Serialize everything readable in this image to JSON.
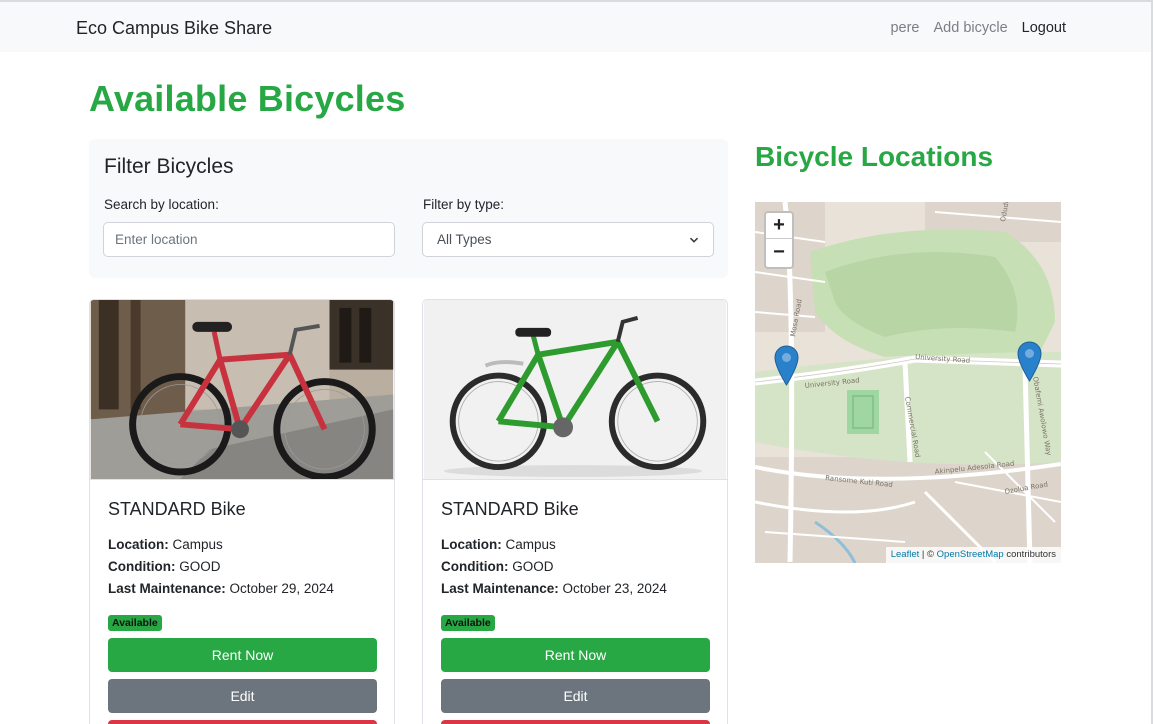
{
  "navbar": {
    "brand": "Eco Campus Bike Share",
    "links": [
      "pere",
      "Add bicycle",
      "Logout"
    ]
  },
  "page": {
    "title": "Available Bicycles"
  },
  "filters": {
    "heading": "Filter Bicycles",
    "location_label": "Search by location:",
    "location_placeholder": "Enter location",
    "location_value": "",
    "type_label": "Filter by type:",
    "type_selected": "All Types"
  },
  "bicycles": [
    {
      "title": "STANDARD Bike",
      "location_label": "Location:",
      "location": "Campus",
      "condition_label": "Condition:",
      "condition": "GOOD",
      "maintenance_label": "Last Maintenance:",
      "maintenance": "October 29, 2024",
      "status": "Available",
      "frame_color": "#c8323f",
      "rent_label": "Rent Now",
      "edit_label": "Edit"
    },
    {
      "title": "STANDARD Bike",
      "location_label": "Location:",
      "location": "Campus",
      "condition_label": "Condition:",
      "condition": "GOOD",
      "maintenance_label": "Last Maintenance:",
      "maintenance": "October 23, 2024",
      "status": "Available",
      "frame_color": "#2e9b2e",
      "rent_label": "Rent Now",
      "edit_label": "Edit"
    }
  ],
  "map": {
    "title": "Bicycle Locations",
    "zoom_in": "+",
    "zoom_out": "−",
    "attribution_leaflet": "Leaflet",
    "attribution_sep": " | © ",
    "attribution_osm": "OpenStreetMap",
    "attribution_suffix": " contributors",
    "road_labels": [
      "University Road",
      "University Road",
      "Commercial Road",
      "Ransome Kuti Road",
      "Akinpelu Adesola Road",
      "Ozolua Road",
      "Oduduwa Way",
      "Obafemi Awolowo Way",
      "Mosa Road"
    ]
  },
  "colors": {
    "brand_green": "#28a745",
    "secondary": "#6c757d",
    "danger": "#dc3545",
    "marker_blue": "#2a81cb"
  }
}
